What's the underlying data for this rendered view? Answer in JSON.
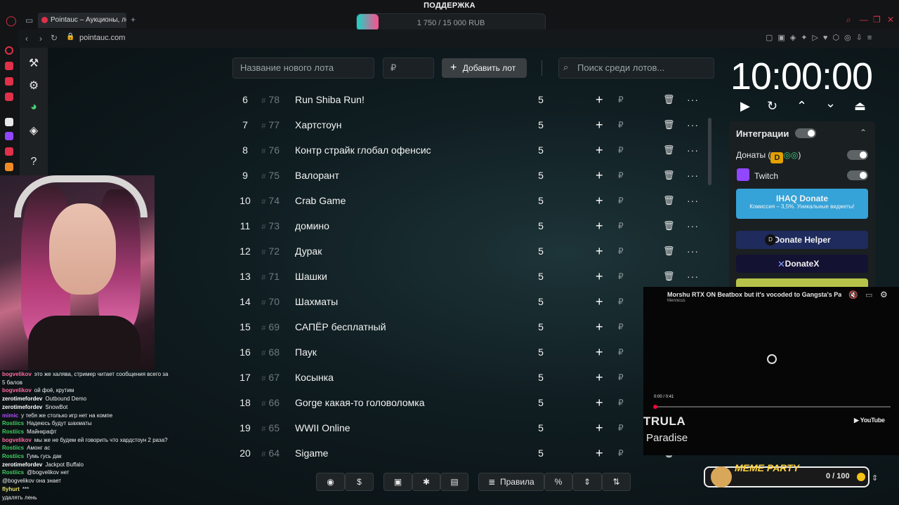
{
  "browser": {
    "tab_title": "Pointauc – Аукционы, лот",
    "url": "pointauc.com",
    "support_label": "ПОДДЕРЖКА",
    "donation_progress": {
      "text": "1 750 / 15 000 RUB",
      "fraction": 0.1167
    }
  },
  "lot_form": {
    "name_placeholder": "Название нового лота",
    "amount_placeholder": "₽",
    "add_label": "Добавить лот",
    "search_placeholder": "Поиск среди лотов..."
  },
  "lots": [
    {
      "idx": "6",
      "num": "78",
      "name": "Run Shiba Run!",
      "amount": "5"
    },
    {
      "idx": "7",
      "num": "77",
      "name": "Хартстоун",
      "amount": "5"
    },
    {
      "idx": "8",
      "num": "76",
      "name": "Контр страйк глобал офенсис",
      "amount": "5"
    },
    {
      "idx": "9",
      "num": "75",
      "name": "Валорант",
      "amount": "5"
    },
    {
      "idx": "10",
      "num": "74",
      "name": "Crab Game",
      "amount": "5"
    },
    {
      "idx": "11",
      "num": "73",
      "name": "домино",
      "amount": "5"
    },
    {
      "idx": "12",
      "num": "72",
      "name": "Дурак",
      "amount": "5"
    },
    {
      "idx": "13",
      "num": "71",
      "name": "Шашки",
      "amount": "5"
    },
    {
      "idx": "14",
      "num": "70",
      "name": "Шахматы",
      "amount": "5"
    },
    {
      "idx": "15",
      "num": "69",
      "name": "САПЁР бесплатный",
      "amount": "5"
    },
    {
      "idx": "16",
      "num": "68",
      "name": "Паук",
      "amount": "5"
    },
    {
      "idx": "17",
      "num": "67",
      "name": "Косынка",
      "amount": "5"
    },
    {
      "idx": "18",
      "num": "66",
      "name": "Gorge какая-то головоломка",
      "amount": "5"
    },
    {
      "idx": "19",
      "num": "65",
      "name": "WWII Online",
      "amount": "5"
    },
    {
      "idx": "20",
      "num": "64",
      "name": "Sigame",
      "amount": "5"
    }
  ],
  "row_icons": {
    "plus": "+",
    "rub": "₽",
    "delete": "🗑",
    "more": "···"
  },
  "timer": {
    "value": "10:00:00"
  },
  "integrations": {
    "title": "Интеграции",
    "donations_label": "Донаты (",
    "donations_suffix": ")",
    "twitch_label": "Twitch",
    "ihaq_title": "IHAQ Donate",
    "ihaq_sub": "Комиссия – 3,5%. Уникальные виджеты!",
    "donate_helper": "Donate Helper",
    "donatex": "DonateX"
  },
  "video": {
    "title": "Morshu RTX ON Beatbox but it's vocoded to Gangsta's Parad",
    "channel": "Mennicus",
    "time": "0:00 / 0:41",
    "brand": "YouTube",
    "artist": "TRULA",
    "song": "Paradise"
  },
  "bottom": {
    "rules_label": "Правила"
  },
  "meme_party": {
    "title": "MEME PARTY",
    "counter": "0 / 100"
  },
  "chat": [
    {
      "user": "bogvelikov",
      "color": "#ff6aa0",
      "text": "это же халява, стример читает сообщения всего за"
    },
    {
      "user": "",
      "color": "#ffffff",
      "text": "5 балов"
    },
    {
      "user": "bogvelikov",
      "color": "#ff6aa0",
      "text": "ой фоё, крутим"
    },
    {
      "user": "zerotimefordev",
      "color": "#ffffff",
      "text": "Outbound Demo"
    },
    {
      "user": "zerotimefordev",
      "color": "#ffffff",
      "text": "SnowBot"
    },
    {
      "user": "mimic",
      "color": "#b04bff",
      "text": "у тебя же столько игр нет на компе"
    },
    {
      "user": "Rostiics",
      "color": "#40d060",
      "text": "Надеюсь будут шахматы"
    },
    {
      "user": "Rostiics",
      "color": "#40d060",
      "text": "Майнкрафт"
    },
    {
      "user": "bogvelikov",
      "color": "#ff6aa0",
      "text": "мы же не будем ей говорить что хардстоун 2 раза?"
    },
    {
      "user": "Rostiics",
      "color": "#40d060",
      "text": "Амонг ас"
    },
    {
      "user": "Rostiics",
      "color": "#40d060",
      "text": "Гумь гусь дак"
    },
    {
      "user": "zerotimefordev",
      "color": "#ffffff",
      "text": "Jackpot Buffalo"
    },
    {
      "user": "Rostiics",
      "color": "#40d060",
      "text": "@bogvelikov нет"
    },
    {
      "user": "",
      "color": "#ffffff",
      "text": "@bogvelikov она знает"
    },
    {
      "user": "flyhurt",
      "color": "#e6e06a",
      "text": "***"
    },
    {
      "user": "",
      "color": "#ffffff",
      "text": "удалять лень"
    }
  ]
}
